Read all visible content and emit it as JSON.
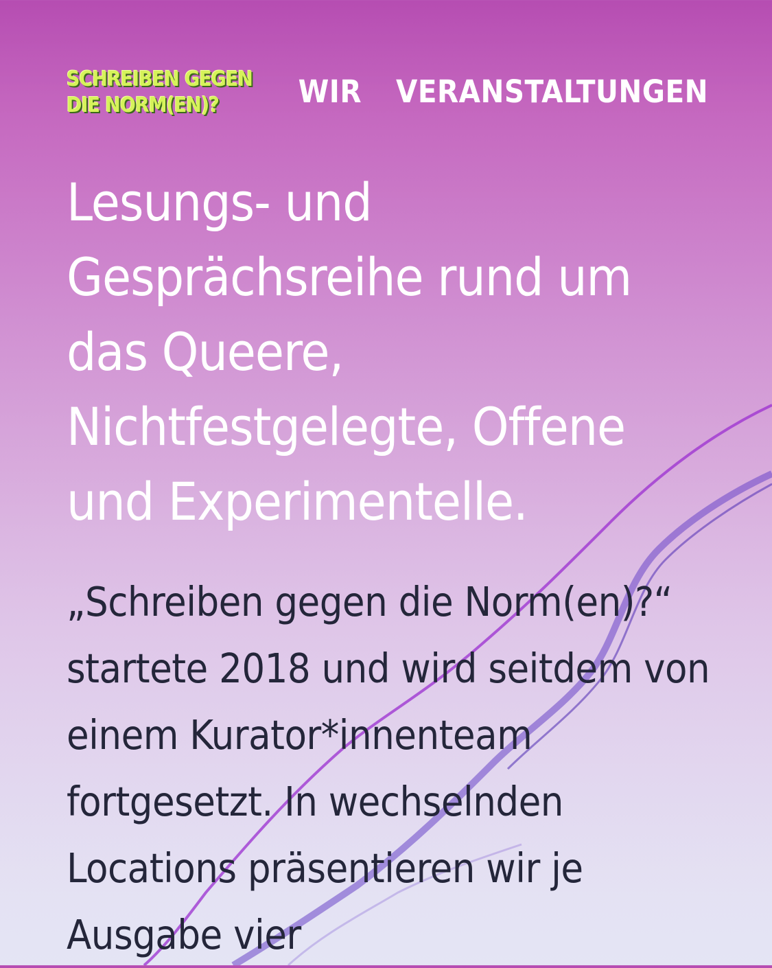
{
  "logo": {
    "line1": "SCHREIBEN GEGEN",
    "line2": "DIE NORM(EN)?"
  },
  "nav": {
    "items": [
      {
        "label": "WIR"
      },
      {
        "label": "VERANSTALTUNGEN"
      }
    ]
  },
  "main": {
    "headline": "Lesungs- und Gesprächsreihe rund um das Queere, Nichtfestgelegte, Offene und Experimentelle.",
    "intro": "„Schreiben gegen die Norm(en)?“ startete 2018 und wird seitdem von einem Kurator*innenteam fortgesetzt. In wechselnden Locations präsentieren wir je Ausgabe vier"
  },
  "colors": {
    "background_top": "#b64db2",
    "background_bottom": "#dcdcf0",
    "logo_green": "#d6f25a",
    "nav_text": "#ffffff",
    "headline_text": "#ffffff",
    "body_text": "#24263a",
    "ink_stroke": "#7b3fd0"
  }
}
